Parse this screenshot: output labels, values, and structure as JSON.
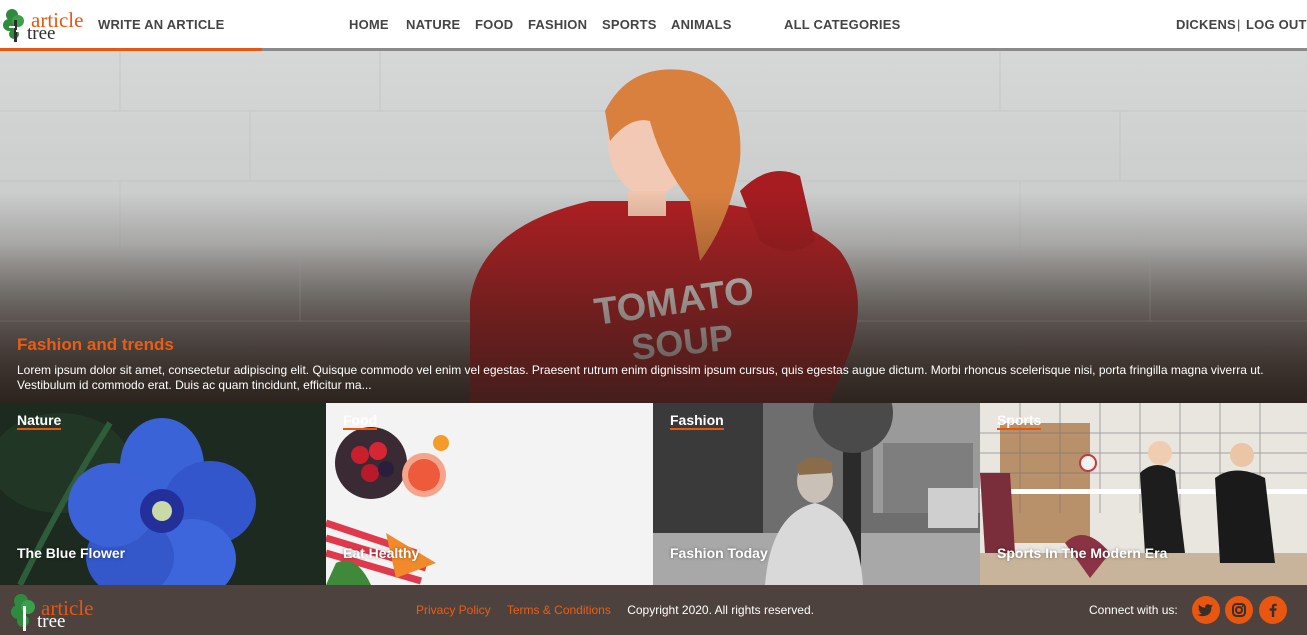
{
  "header": {
    "logo": {
      "word1": "article",
      "word2": "tree"
    },
    "write_link": "WRITE AN ARTICLE",
    "nav": {
      "home": "HOME",
      "nature": "NATURE",
      "food": "FOOD",
      "fashion": "FASHION",
      "sports": "SPORTS",
      "animals": "ANIMALS",
      "all_categories": "ALL CATEGORIES"
    },
    "user": {
      "name": "DICKENS",
      "separator": "|",
      "logout": "LOG OUT"
    }
  },
  "hero": {
    "title": "Fashion and trends",
    "text": "Lorem ipsum dolor sit amet, consectetur adipiscing elit. Quisque commodo vel enim vel egestas. Praesent rutrum enim dignissim ipsum cursus, quis egestas augue dictum. Morbi rhoncus scelerisque nisi, porta fringilla magna viverra ut. Vestibulum id commodo erat. Duis ac quam tincidunt, efficitur ma..."
  },
  "tiles": [
    {
      "category": "Nature",
      "title": "The Blue Flower"
    },
    {
      "category": "Food",
      "title": "Eat Healthy"
    },
    {
      "category": "Fashion",
      "title": "Fashion Today"
    },
    {
      "category": "Sports",
      "title": "Sports In The Modern Era"
    }
  ],
  "footer": {
    "logo": {
      "word1": "article",
      "word2": "tree"
    },
    "privacy": "Privacy Policy",
    "terms": "Terms & Conditions",
    "copyright": "Copyright 2020. All rights reserved.",
    "connect": "Connect with us:",
    "social_icons": [
      "twitter-icon",
      "instagram-icon",
      "facebook-icon"
    ]
  },
  "colors": {
    "accent": "#e8560f",
    "footer_bg": "#4d423d",
    "nav_text": "#444444"
  }
}
